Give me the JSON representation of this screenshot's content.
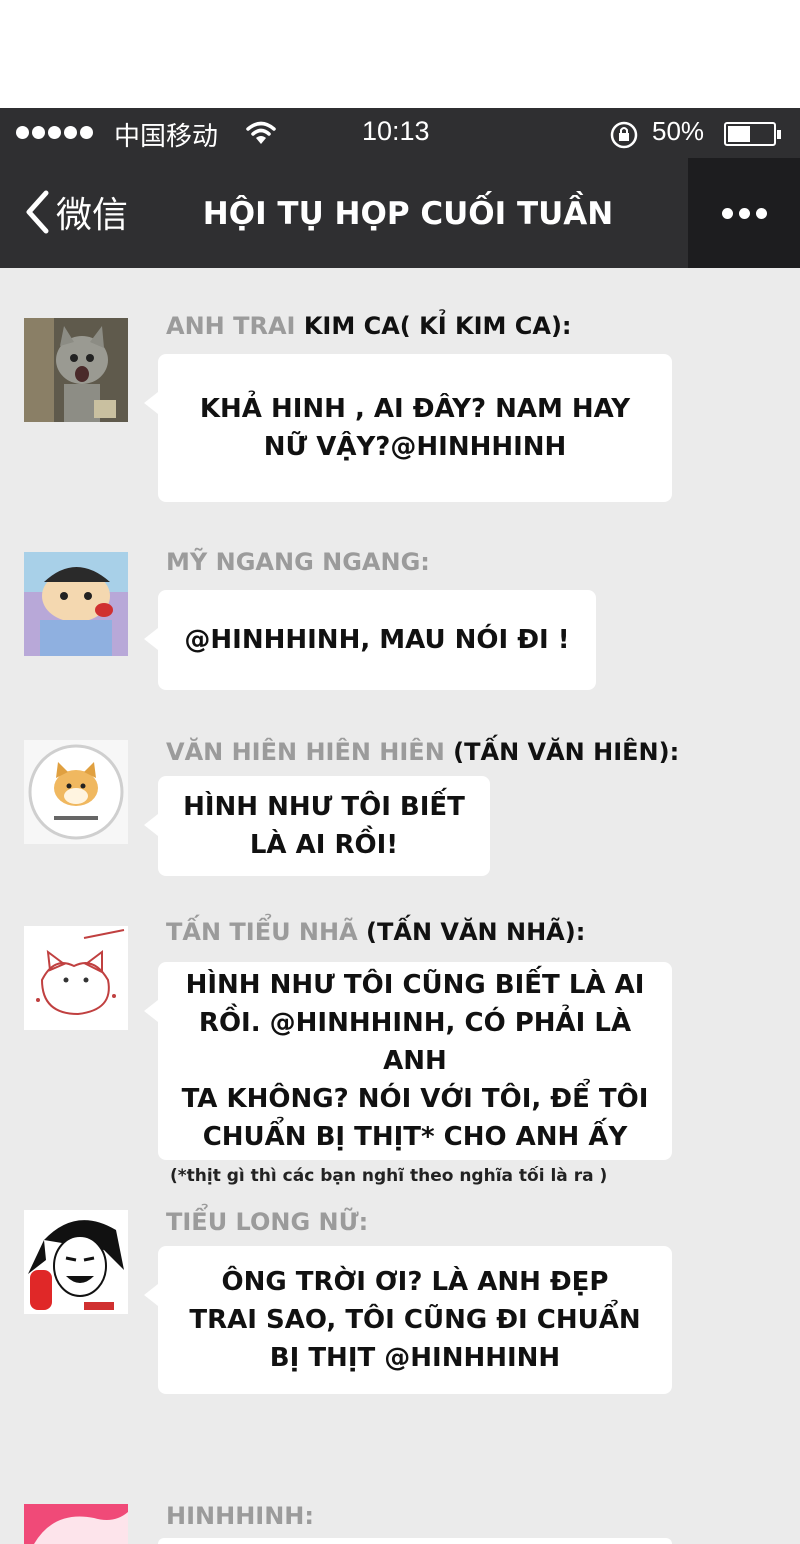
{
  "status_bar": {
    "carrier": "中国移动",
    "time": "10:13",
    "battery": "50%",
    "battery_level": 0.5
  },
  "nav": {
    "back_label": "微信",
    "title": "HỘI TỤ HỌP CUỐI TUẦN"
  },
  "messages": [
    {
      "sender_nick": "ANH TRAI",
      "sender_name": "KIM CA( KỈ KIM CA):",
      "line1": "KHẢ HINH , AI ĐÂY? NAM HAY",
      "line2": "NỮ VẬY?@HINHHINH"
    },
    {
      "sender_nick": "MỸ NGANG NGANG:",
      "sender_name": "",
      "line1": "@HINHHINH, MAU NÓI ĐI !"
    },
    {
      "sender_nick": "VĂN HIÊN HIÊN HIÊN",
      "sender_name": "(TẤN VĂN HIÊN):",
      "line1": "HÌNH NHƯ TÔI BIẾT",
      "line2": "LÀ AI RỒI!"
    },
    {
      "sender_nick": "TẤN TIỂU NHÃ",
      "sender_name": "(TẤN VĂN NHÃ):",
      "line1": "HÌNH NHƯ TÔI CŨNG BIẾT LÀ AI",
      "line2": "RỒI. @HINHHINH, CÓ PHẢI LÀ ANH",
      "line3": "TA KHÔNG? NÓI VỚI TÔI, ĐỂ TÔI",
      "line4": "CHUẨN BỊ THỊT* CHO ANH ẤY"
    },
    {
      "sender_nick": "TIỂU LONG NỮ:",
      "sender_name": "",
      "line1": "ÔNG TRỜI ƠI? LÀ ANH ĐẸP",
      "line2": "TRAI SAO, TÔI CŨNG ĐI CHUẨN",
      "line3": "BỊ THỊT @HINHHINH"
    },
    {
      "sender_nick": "HINHHINH:",
      "sender_name": ""
    }
  ],
  "footnote": "(*thịt gì thì các bạn nghĩ theo nghĩa tối là ra )"
}
